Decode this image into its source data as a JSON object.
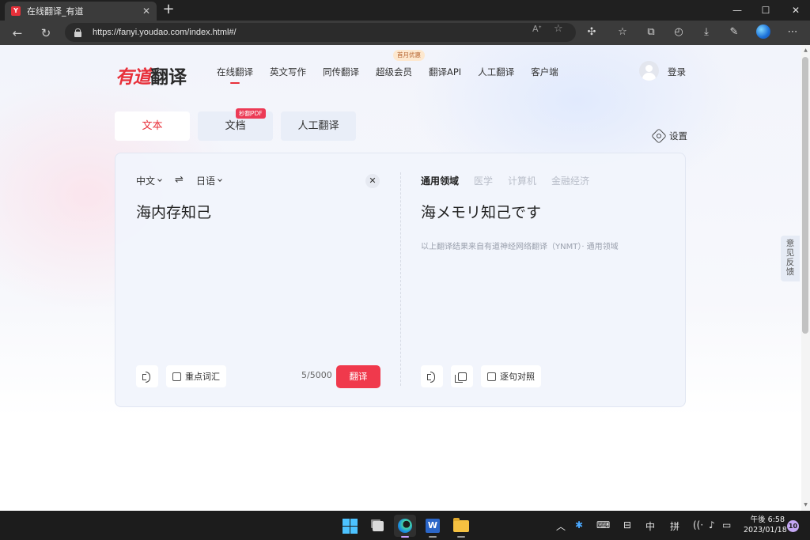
{
  "browser": {
    "tab_title": "在线翻译_有道",
    "url": "https://fanyi.youdao.com/index.html#/"
  },
  "site": {
    "logo_brand": "有道",
    "logo_sub": "翻译",
    "nav": [
      "在线翻译",
      "英文写作",
      "同传翻译",
      "超级会员",
      "翻译API",
      "人工翻译",
      "客户端"
    ],
    "promo_badge": "首月优惠",
    "login": "登录"
  },
  "mode_tabs": {
    "text": "文本",
    "document": "文档",
    "human": "人工翻译",
    "pdf_badge": "秒翻PDF"
  },
  "settings_label": "设置",
  "translator": {
    "source_lang": "中文",
    "target_lang": "日语",
    "swap_icon": "⇌",
    "source_text": "海内存知己",
    "target_text": "海メモリ知己です",
    "engine_note": "以上翻译结果来自有道神经网络翻译（YNMT）· 通用领域",
    "domains": [
      "通用领域",
      "医学",
      "计算机",
      "金融经济"
    ],
    "keywords_label": "重点词汇",
    "char_count": "5/5000",
    "translate_button": "翻译",
    "sentence_compare_label": "逐句对照"
  },
  "feedback_label": "意见反馈",
  "taskbar": {
    "time": "午後 6:58",
    "date": "2023/01/18",
    "ime_mode": "中",
    "ime_pinyin": "拼",
    "notification_count": "10"
  },
  "colors": {
    "brand_red": "#e8303a",
    "translate_button": "#f0394c",
    "pdf_badge": "#ec3a55"
  }
}
